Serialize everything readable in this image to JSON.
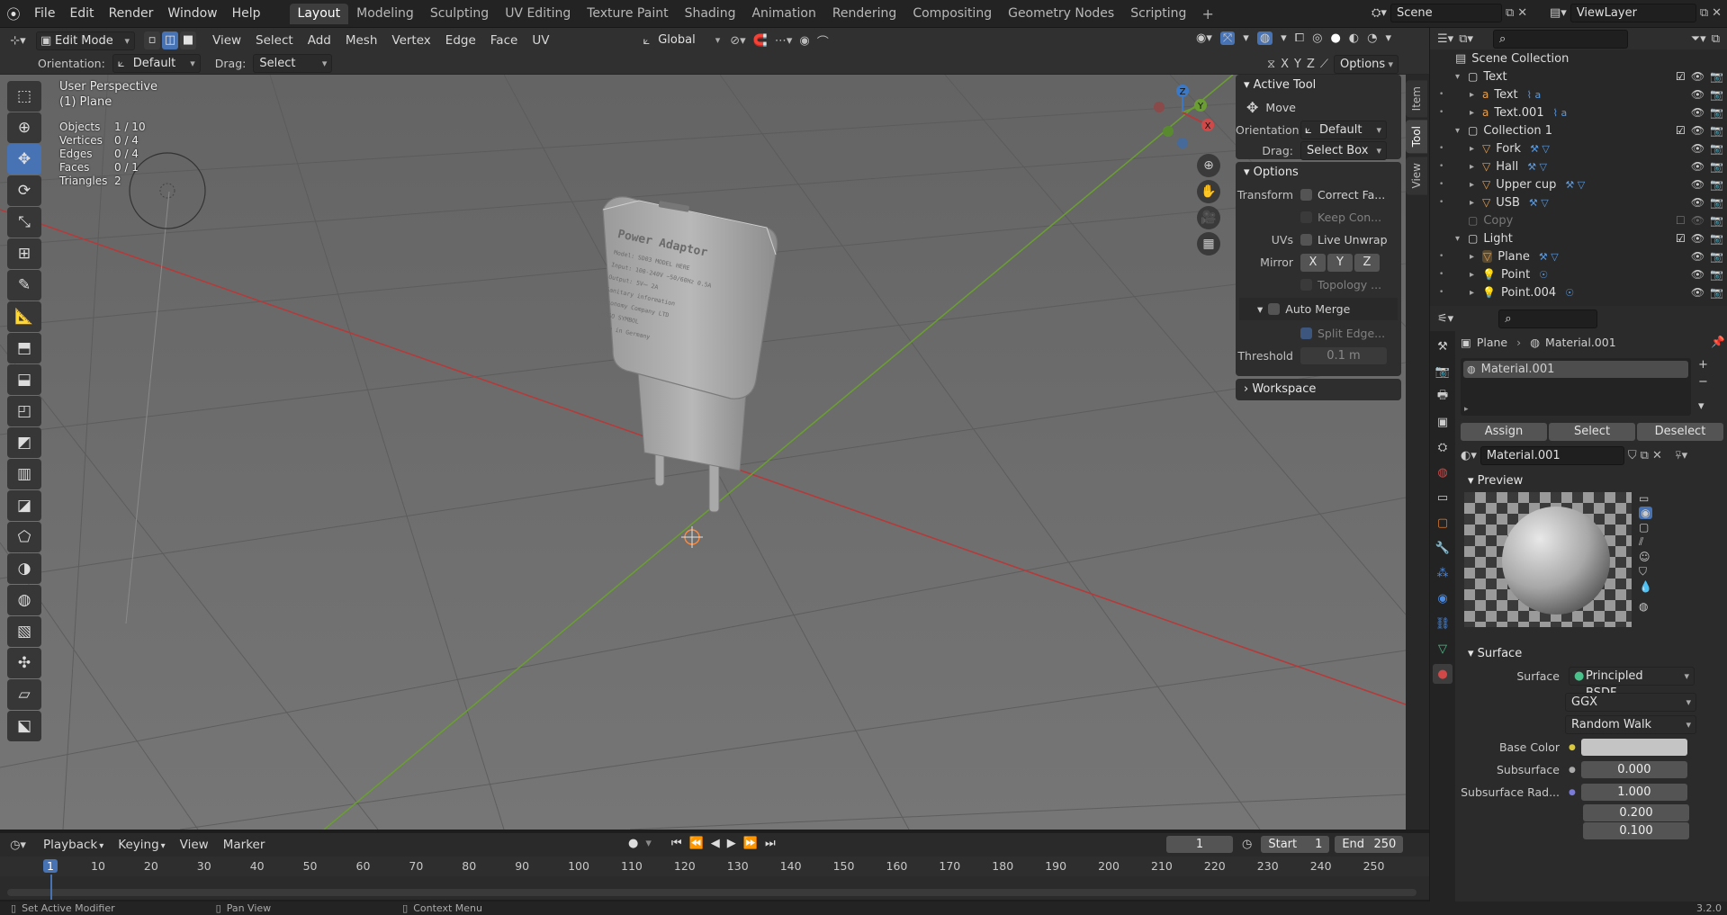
{
  "app": {
    "mode": "Edit Mode"
  },
  "menu": [
    "File",
    "Edit",
    "Render",
    "Window",
    "Help"
  ],
  "workspaces": [
    "Layout",
    "Modeling",
    "Sculpting",
    "UV Editing",
    "Texture Paint",
    "Shading",
    "Animation",
    "Rendering",
    "Compositing",
    "Geometry Nodes",
    "Scripting"
  ],
  "active_workspace": "Layout",
  "scene": {
    "label": "Scene",
    "viewlayer": "ViewLayer"
  },
  "header": {
    "view_menus": [
      "View",
      "Select",
      "Add",
      "Mesh",
      "Vertex",
      "Edge",
      "Face",
      "UV"
    ],
    "transform_orientation": "Global",
    "orientation_label": "Orientation:",
    "orientation_value": "Default",
    "drag_label": "Drag:",
    "drag_value": "Select Box",
    "axes": [
      "X",
      "Y",
      "Z"
    ],
    "options": "Options"
  },
  "viewport": {
    "perspective": "User Perspective",
    "object": "(1) Plane",
    "stats": [
      {
        "label": "Objects",
        "value": "1 / 10"
      },
      {
        "label": "Vertices",
        "value": "0 / 4"
      },
      {
        "label": "Edges",
        "value": "0 / 4"
      },
      {
        "label": "Faces",
        "value": "0 / 1"
      },
      {
        "label": "Triangles",
        "value": "2"
      }
    ],
    "gizmo_axes": [
      "Z",
      "Y",
      "X"
    ]
  },
  "model": {
    "title": "Power Adaptor",
    "lines": [
      "Model: SD03 MODEL HERE",
      "Input: 100-240V ~50/60Hz 0.5A",
      "Output: 5V⎓ 2A",
      "Sanitary information",
      "Economy Company LTD",
      "LOGO  SYMBOL",
      "Made in Germany"
    ]
  },
  "npanel": {
    "active_tool": "Active Tool",
    "tool_name": "Move",
    "orientation_label": "Orientation",
    "orientation_value": "Default",
    "drag_label": "Drag:",
    "drag_value": "Select Box",
    "options": "Options",
    "transform_label": "Transform",
    "correct_face": "Correct Fa...",
    "keep_connected": "Keep Con...",
    "uvs_label": "UVs",
    "live_unwrap": "Live Unwrap",
    "mirror_label": "Mirror",
    "mirror_axes": [
      "X",
      "Y",
      "Z"
    ],
    "topology": "Topology ...",
    "auto_merge": "Auto Merge",
    "split_edges": "Split Edge...",
    "threshold_label": "Threshold",
    "threshold_value": "0.1 m",
    "workspace": "Workspace",
    "tabs": [
      "Item",
      "Tool",
      "View"
    ]
  },
  "outliner": {
    "root": "Scene Collection",
    "rows": [
      {
        "name": "Text",
        "level": 1,
        "kind": "collection"
      },
      {
        "name": "Text",
        "level": 2,
        "kind": "text"
      },
      {
        "name": "Text.001",
        "level": 2,
        "kind": "text"
      },
      {
        "name": "Collection 1",
        "level": 1,
        "kind": "collection"
      },
      {
        "name": "Fork",
        "level": 2,
        "kind": "mesh"
      },
      {
        "name": "Hall",
        "level": 2,
        "kind": "mesh"
      },
      {
        "name": "Upper cup",
        "level": 2,
        "kind": "mesh"
      },
      {
        "name": "USB",
        "level": 2,
        "kind": "mesh"
      },
      {
        "name": "Copy",
        "level": 1,
        "kind": "disabled"
      },
      {
        "name": "Light",
        "level": 1,
        "kind": "collection"
      },
      {
        "name": "Plane",
        "level": 2,
        "kind": "mesh-active"
      },
      {
        "name": "Point",
        "level": 2,
        "kind": "light"
      },
      {
        "name": "Point.004",
        "level": 2,
        "kind": "light"
      }
    ]
  },
  "properties": {
    "breadcrumb_object": "Plane",
    "breadcrumb_material": "Material.001",
    "slot": "Material.001",
    "assign": "Assign",
    "select": "Select",
    "deselect": "Deselect",
    "material_name": "Material.001",
    "preview": "Preview",
    "surface_section": "Surface",
    "surface_label": "Surface",
    "surface_value": "Principled BSDF",
    "distribution": "GGX",
    "subsurface_method": "Random Walk",
    "base_color_label": "Base Color",
    "subsurface_label": "Subsurface",
    "subsurface_value": "0.000",
    "subsurface_radius_label": "Subsurface Rad...",
    "subsurface_radius": [
      "1.000",
      "0.200",
      "0.100"
    ]
  },
  "timeline": {
    "menus": [
      "Playback",
      "Keying",
      "View",
      "Marker"
    ],
    "current_frame": "1",
    "start_label": "Start",
    "start": "1",
    "end_label": "End",
    "end": "250",
    "ticks": [
      "1",
      "10",
      "20",
      "30",
      "40",
      "50",
      "60",
      "70",
      "80",
      "90",
      "100",
      "110",
      "120",
      "130",
      "140",
      "150",
      "160",
      "170",
      "180",
      "190",
      "200",
      "210",
      "220",
      "230",
      "240",
      "250"
    ]
  },
  "status": {
    "left": "Set Active Modifier",
    "middle": "Pan View",
    "right": "Context Menu",
    "version": "3.2.0"
  },
  "colors": {
    "accent": "#4772b3",
    "x_axis": "#b33b3b",
    "y_axis": "#6a9d32",
    "z_axis": "#3b79c7"
  }
}
